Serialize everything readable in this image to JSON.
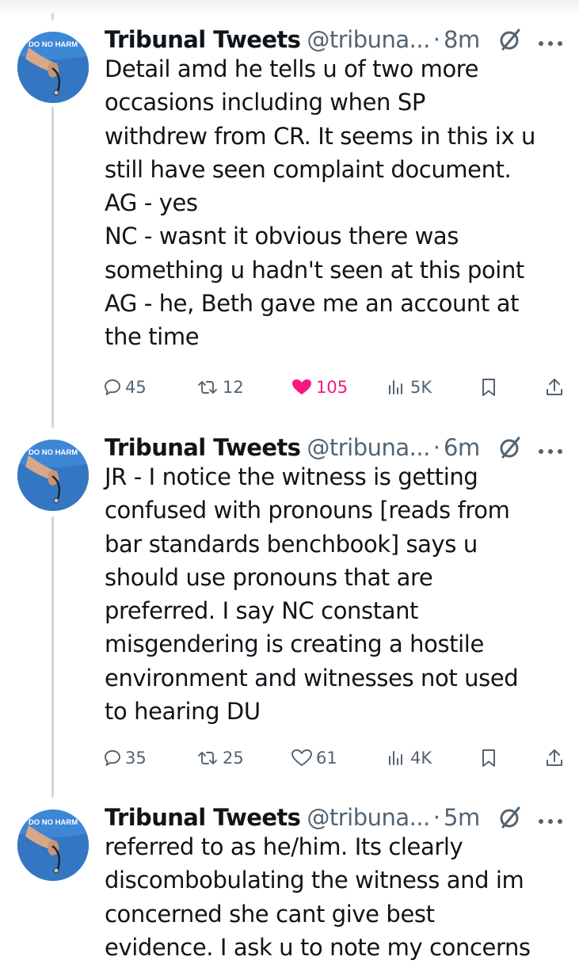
{
  "tweets": [
    {
      "name": "Tribunal Tweets",
      "handle": "@tribuna...",
      "time": "8m",
      "avatar_text": "DO NO HARM",
      "lines": [
        "Detail amd he tells u of two more",
        "occasions including when SP",
        "withdrew from CR. It seems in this ix u",
        "still have seen complaint document.",
        "AG - yes",
        "NC - wasnt it obvious there was",
        "something u hadn't seen at this point",
        "AG - he, Beth gave me an account at",
        "the time"
      ],
      "replies": "45",
      "reposts": "12",
      "likes": "105",
      "liked": true,
      "views": "5K"
    },
    {
      "name": "Tribunal Tweets",
      "handle": "@tribuna...",
      "time": "6m",
      "avatar_text": "DO NO HARM",
      "lines": [
        "JR - I notice the witness is getting",
        "confused with pronouns [reads from",
        "bar standards benchbook] says u",
        "should use pronouns that are",
        "preferred. I say NC constant",
        "misgendering is creating a hostile",
        "environment and witnesses not used",
        "to hearing DU"
      ],
      "replies": "35",
      "reposts": "25",
      "likes": "61",
      "liked": false,
      "views": "4K"
    },
    {
      "name": "Tribunal Tweets",
      "handle": "@tribuna...",
      "time": "5m",
      "avatar_text": "DO NO HARM",
      "lines": [
        "referred to as he/him. Its clearly",
        "discombobulating the witness and im",
        "concerned she cant give best",
        "evidence. I ask u to note my concerns"
      ]
    }
  ],
  "colors": {
    "text": "#0f1419",
    "secondary": "#536471",
    "like_pink": "#f91880",
    "thread_line": "#cfd9de",
    "avatar_blue": "#3e86d6"
  },
  "icons": [
    "reply-icon",
    "repost-icon",
    "like-icon",
    "views-icon",
    "bookmark-icon",
    "share-icon",
    "grok-icon",
    "more-icon"
  ]
}
